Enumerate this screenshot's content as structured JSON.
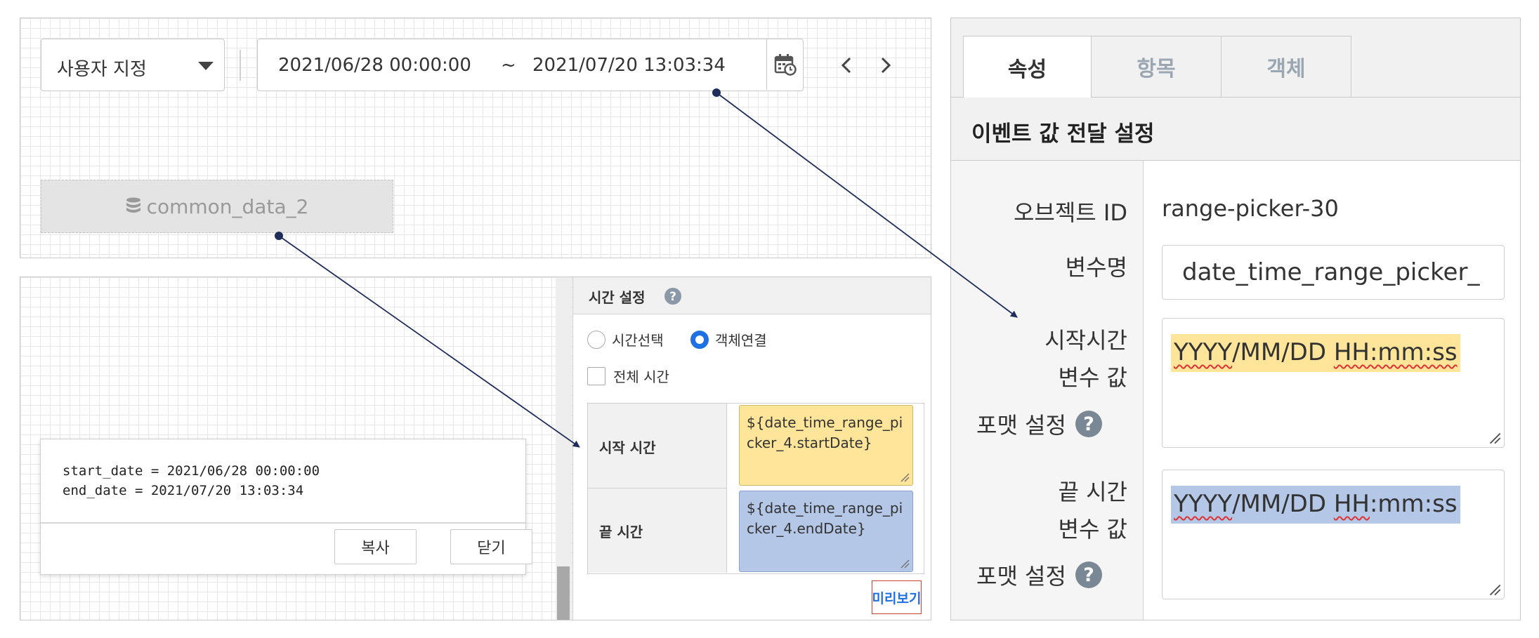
{
  "toolbar": {
    "range_type": "사용자 지정",
    "range_start": "2021/06/28 00:00:00",
    "range_sep": "~",
    "range_end": "2021/07/20 13:03:34"
  },
  "data_source": {
    "label": "common_data_2"
  },
  "time_settings": {
    "title": "시간 설정",
    "radio_time_select": "시간선택",
    "radio_object_link": "객체연결",
    "checkbox_all_time": "전체 시간",
    "start_label": "시작 시간",
    "start_value": "${date_time_range_picker_4.startDate}",
    "end_label": "끝 시간",
    "end_value": "${date_time_range_picker_4.endDate}",
    "preview_label": "미리보기"
  },
  "preview_dialog": {
    "line1": "start_date = 2021/06/28 00:00:00",
    "line2": "end_date = 2021/07/20 13:03:34",
    "copy_label": "복사",
    "close_label": "닫기"
  },
  "properties": {
    "tabs": [
      "속성",
      "항목",
      "객체"
    ],
    "section_title": "이벤트 값 전달 설정",
    "object_id_label": "오브젝트 ID",
    "object_id_value": "range-picker-30",
    "variable_name_label": "변수명",
    "variable_name_value": "date_time_range_picker_",
    "start_label_line1": "시작시간",
    "start_label_line2": "변수 값",
    "start_format_label": "포맷 설정",
    "start_format_value": "YYYY/MM/DD HH:mm:ss",
    "end_label_line1": "끝 시간",
    "end_label_line2": "변수 값",
    "end_format_label": "포맷 설정",
    "end_format_value": "YYYY/MM/DD HH:mm:ss"
  },
  "colors": {
    "accent_blue": "#1f6fe5",
    "highlight_yellow": "#ffe599",
    "highlight_blue": "#b4c7e7",
    "preview_border": "#d04030",
    "arrow": "#1f2d5a"
  }
}
